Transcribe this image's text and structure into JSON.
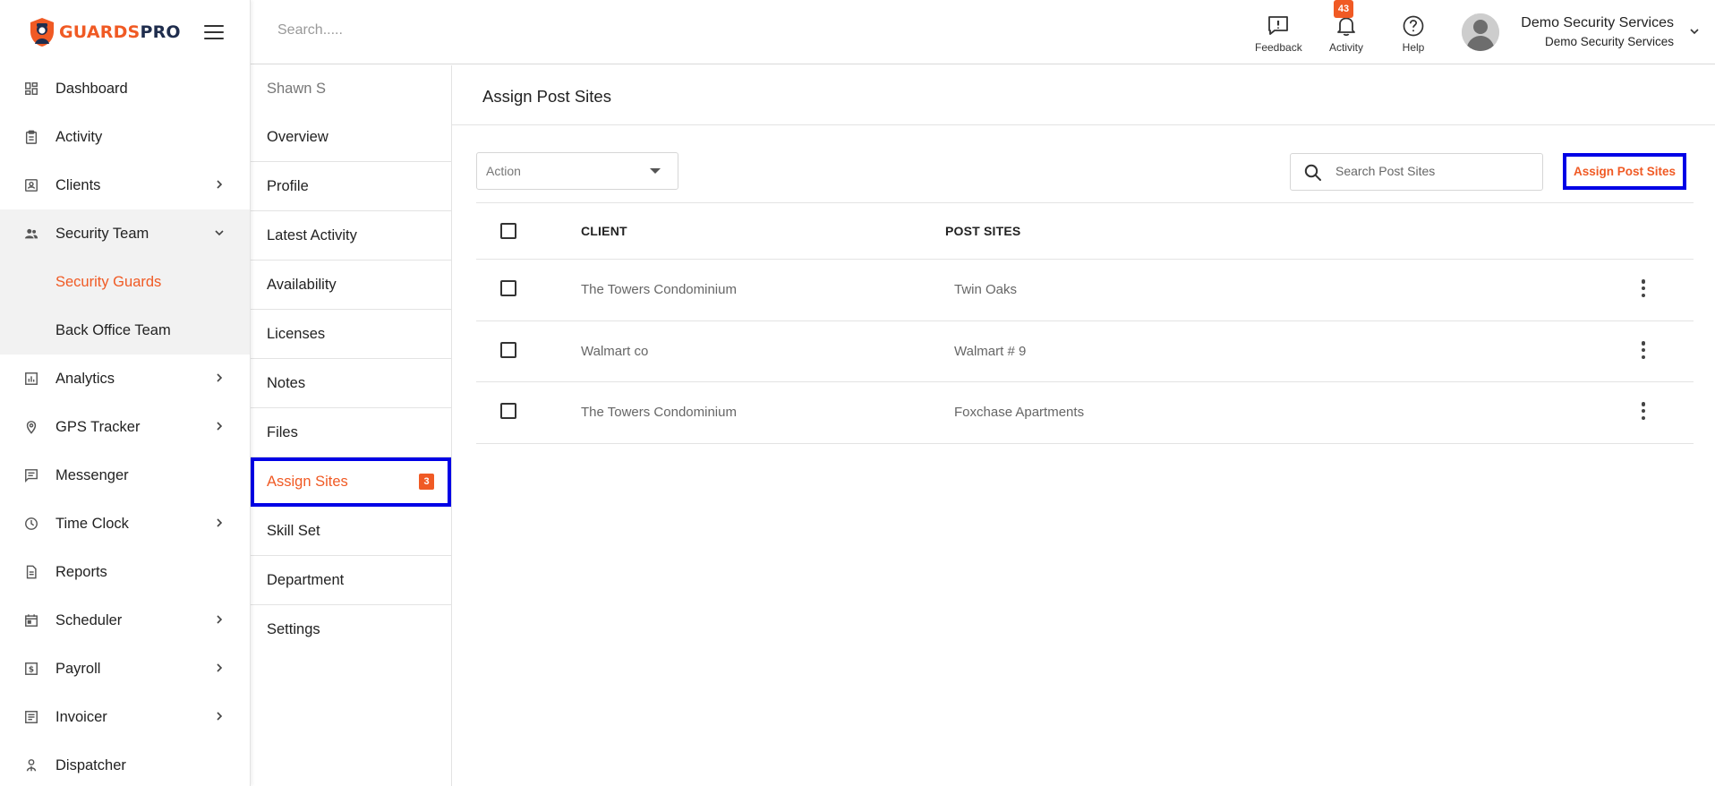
{
  "brand": {
    "part1": "GUARDS",
    "part2": "PRO"
  },
  "sidebar": {
    "items": [
      {
        "label": "Dashboard",
        "icon": "dashboard-icon",
        "expandable": false
      },
      {
        "label": "Activity",
        "icon": "clipboard-icon",
        "expandable": false
      },
      {
        "label": "Clients",
        "icon": "id-card-icon",
        "expandable": true
      },
      {
        "label": "Security Team",
        "icon": "people-icon",
        "expandable": true,
        "open": true,
        "children": [
          {
            "label": "Security Guards",
            "active": true
          },
          {
            "label": "Back Office Team",
            "active": false
          }
        ]
      },
      {
        "label": "Analytics",
        "icon": "bar-chart-icon",
        "expandable": true
      },
      {
        "label": "GPS Tracker",
        "icon": "location-pin-icon",
        "expandable": true
      },
      {
        "label": "Messenger",
        "icon": "chat-icon",
        "expandable": false
      },
      {
        "label": "Time Clock",
        "icon": "clock-icon",
        "expandable": true
      },
      {
        "label": "Reports",
        "icon": "document-icon",
        "expandable": false
      },
      {
        "label": "Scheduler",
        "icon": "calendar-icon",
        "expandable": true
      },
      {
        "label": "Payroll",
        "icon": "dollar-icon",
        "expandable": true
      },
      {
        "label": "Invoicer",
        "icon": "invoice-icon",
        "expandable": true
      },
      {
        "label": "Dispatcher",
        "icon": "dispatcher-icon",
        "expandable": false
      }
    ]
  },
  "topbar": {
    "search_placeholder": "Search.....",
    "feedback_label": "Feedback",
    "activity_label": "Activity",
    "activity_count": "43",
    "help_label": "Help",
    "user_name": "Demo Security Services",
    "user_company": "Demo Security Services"
  },
  "profile_nav": {
    "person": "Shawn S",
    "items": [
      {
        "label": "Overview"
      },
      {
        "label": "Profile"
      },
      {
        "label": "Latest Activity"
      },
      {
        "label": "Availability"
      },
      {
        "label": "Licenses"
      },
      {
        "label": "Notes"
      },
      {
        "label": "Files"
      },
      {
        "label": "Assign Sites",
        "active": true,
        "badge": "3"
      },
      {
        "label": "Skill Set"
      },
      {
        "label": "Department"
      },
      {
        "label": "Settings"
      }
    ]
  },
  "main": {
    "title": "Assign Post Sites",
    "action_label": "Action",
    "search_placeholder": "Search Post Sites",
    "assign_button": "Assign Post Sites",
    "columns": {
      "client": "CLIENT",
      "post_sites": "POST SITES"
    },
    "rows": [
      {
        "client": "The Towers Condominium",
        "post_site": "Twin Oaks"
      },
      {
        "client": "Walmart co",
        "post_site": "Walmart # 9"
      },
      {
        "client": "The Towers Condominium",
        "post_site": "Foxchase Apartments"
      }
    ]
  },
  "colors": {
    "accent": "#f05a24",
    "highlight_border": "#0000e6",
    "brand_dark": "#1f2d4d"
  }
}
